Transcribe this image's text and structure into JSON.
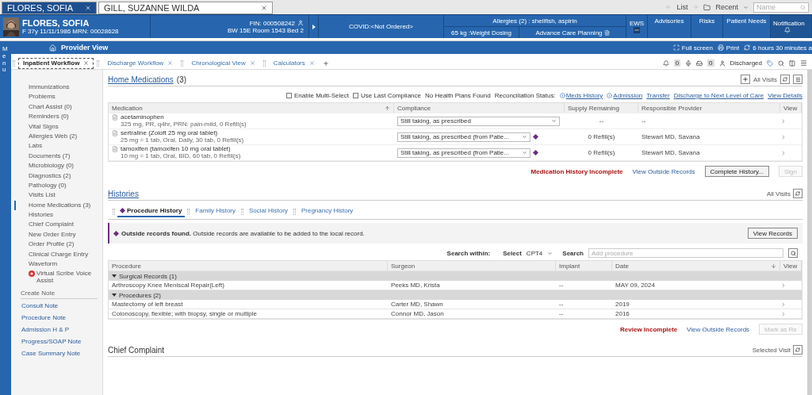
{
  "patient_tabs": [
    {
      "label": "FLORES, SOFIA",
      "selected": true
    },
    {
      "label": "GILL, SUZANNE WILDA",
      "selected": false
    }
  ],
  "nav": {
    "list": "List",
    "recent": "Recent",
    "search_placeholder": "Name"
  },
  "banner": {
    "name": "FLORES, SOFIA",
    "demographics": "F 37y  11/11/1986  MRN: 00028628",
    "fin": "FIN: 000508242",
    "location": "BW 15E Room 1543 Bed 2",
    "covid": "COVID:<Not Ordered>",
    "allergies": "Allergies (2) : shellfish, aspirin",
    "weight": "65 kg :Weight Dosing",
    "acp": "Advance Care Planning",
    "ews": "EWS",
    "advisories": "Advisories",
    "risks": "Risks",
    "patient_needs": "Patient Needs",
    "notifications": "Notification"
  },
  "provider_bar": {
    "title": "Provider View",
    "full_screen": "Full screen",
    "print": "Print",
    "refresh": "6 hours 30 minutes a"
  },
  "menu_label": "Menu",
  "view_tabs": [
    {
      "label": "Inpatient Workflow",
      "selected": true
    },
    {
      "label": "Discharge Workflow",
      "selected": false
    },
    {
      "label": "Chronological View",
      "selected": false
    },
    {
      "label": "Calculators",
      "selected": false
    }
  ],
  "toolbar": {
    "alerts_count": "0",
    "inbox_count": "0",
    "status": "Discharged"
  },
  "sidebar": {
    "items": [
      {
        "label": "Immunizations",
        "selected": false,
        "kind": "item"
      },
      {
        "label": "Problems",
        "selected": false,
        "kind": "item"
      },
      {
        "label": "Chart Assist (0)",
        "selected": false,
        "kind": "item"
      },
      {
        "label": "Reminders (0)",
        "selected": false,
        "kind": "item"
      },
      {
        "label": "Vital Signs",
        "selected": false,
        "kind": "item"
      },
      {
        "label": "Allergies Web (2)",
        "selected": false,
        "kind": "item"
      },
      {
        "label": "Labs",
        "selected": false,
        "kind": "item"
      },
      {
        "label": "Documents (7)",
        "selected": false,
        "kind": "item"
      },
      {
        "label": "Microbiology (0)",
        "selected": false,
        "kind": "item"
      },
      {
        "label": "Diagnostics (2)",
        "selected": false,
        "kind": "item"
      },
      {
        "label": "Pathology (0)",
        "selected": false,
        "kind": "item"
      },
      {
        "label": "Visits List",
        "selected": false,
        "kind": "item"
      },
      {
        "label": "Home Medications (3)",
        "selected": true,
        "kind": "item"
      },
      {
        "label": "Histories",
        "selected": false,
        "kind": "item"
      },
      {
        "label": "Chief Complaint",
        "selected": false,
        "kind": "item"
      },
      {
        "label": "New Order Entry",
        "selected": false,
        "kind": "item"
      },
      {
        "label": "Order Profile (2)",
        "selected": false,
        "kind": "item"
      },
      {
        "label": "Clinical Charge Entry",
        "selected": false,
        "kind": "item"
      },
      {
        "label": "Waveform",
        "selected": false,
        "kind": "item"
      },
      {
        "label": "Virtual Scribe Voice Assist",
        "selected": false,
        "kind": "voice"
      }
    ],
    "create_note": {
      "title": "Create Note",
      "links": [
        "Consult Note",
        "Procedure Note",
        "Admission H & P",
        "Progress/SOAP Note",
        "Case Summary Note"
      ]
    }
  },
  "home_medications": {
    "title": "Home Medications",
    "count": "(3)",
    "all_visits": "All Visits",
    "options": [
      {
        "label": "Enable Multi-Select",
        "checked": false
      },
      {
        "label": "Use Last Compliance",
        "checked": false
      }
    ],
    "no_health_plans": "No Health Plans Found",
    "recon_label": "Reconciliation Status:",
    "links": [
      {
        "label": "Meds History",
        "info": true
      },
      {
        "label": "Admission",
        "info": true
      },
      {
        "label": "Transfer",
        "info": false
      },
      {
        "label": "Discharge to Next Level of Care",
        "info": false
      },
      {
        "label": "View Details",
        "info": false
      }
    ],
    "columns": [
      "Medication",
      "Compliance",
      "Supply Remaining",
      "Responsible Provider",
      "View"
    ],
    "rows": [
      {
        "name": "acetaminophen",
        "detail": "325 mg, PR, q4hr, PRN: pain-mild, 0 Refill(s)",
        "compliance": "Still taking, as prescribed",
        "outside": false,
        "supply": "--",
        "provider": "--"
      },
      {
        "name": "sertraline (Zoloft 25 mg oral tablet)",
        "detail": "25 mg = 1 tab, Oral, Daily, 30 tab, 0 Refill(s)",
        "compliance": "Still taking, as prescribed (from Patie...",
        "outside": true,
        "supply": "0 Refill(s)",
        "provider": "Stewart MD, Savana"
      },
      {
        "name": "tamoxifen (tamoxifen 10 mg oral tablet)",
        "detail": "10 mg = 1 tab, Oral, BID, 60 tab, 0 Refill(s)",
        "compliance": "Still taking, as prescribed (from Patie...",
        "outside": true,
        "supply": "0 Refill(s)",
        "provider": "Stewart MD, Savana"
      }
    ],
    "status": "Medication History Incomplete",
    "outside_link": "View Outside Records",
    "buttons": [
      {
        "label": "Complete History...",
        "disabled": false
      },
      {
        "label": "Sign",
        "disabled": true
      }
    ]
  },
  "histories": {
    "title": "Histories",
    "all_visits": "All Visits",
    "tabs": [
      {
        "label": "Procedure History",
        "selected": true,
        "outside": true
      },
      {
        "label": "Family History",
        "selected": false,
        "outside": false
      },
      {
        "label": "Social History",
        "selected": false,
        "outside": false
      },
      {
        "label": "Pregnancy History",
        "selected": false,
        "outside": false
      }
    ],
    "alert": {
      "title": "Outside records found.",
      "text": "Outside records are available to be added to the local record.",
      "button": "View Records"
    },
    "search": {
      "within": "Search within:",
      "select_label": "Select",
      "select_value": "CPT4",
      "search_label": "Search",
      "placeholder": "Add procedure"
    },
    "columns": [
      "Procedure",
      "Surgeon",
      "Implant",
      "Date",
      "View"
    ],
    "groups": [
      {
        "label": "Surgical Records (1)",
        "expanded": true,
        "rows": [
          {
            "procedure": "Arthroscopy Knee Meniscal Repair(Left)",
            "surgeon": "Peeks MD, Krista",
            "implant": "--",
            "date": "MAY 09, 2024"
          }
        ]
      },
      {
        "label": "Procedures (2)",
        "expanded": true,
        "rows": [
          {
            "procedure": "Mastectomy of left breast",
            "surgeon": "Carter MD, Shawn",
            "implant": "--",
            "date": "2019"
          },
          {
            "procedure": "Colonoscopy, flexible; with biopsy, single or multiple",
            "surgeon": "Connor MD, Jason",
            "implant": "--",
            "date": "2016"
          }
        ]
      }
    ],
    "status": "Review Incomplete",
    "outside_link": "View Outside Records",
    "mark_button": {
      "label": "Mark as Re",
      "disabled": true
    }
  },
  "chief_complaint": {
    "title": "Chief Complaint",
    "visit": "Selected Visit"
  }
}
